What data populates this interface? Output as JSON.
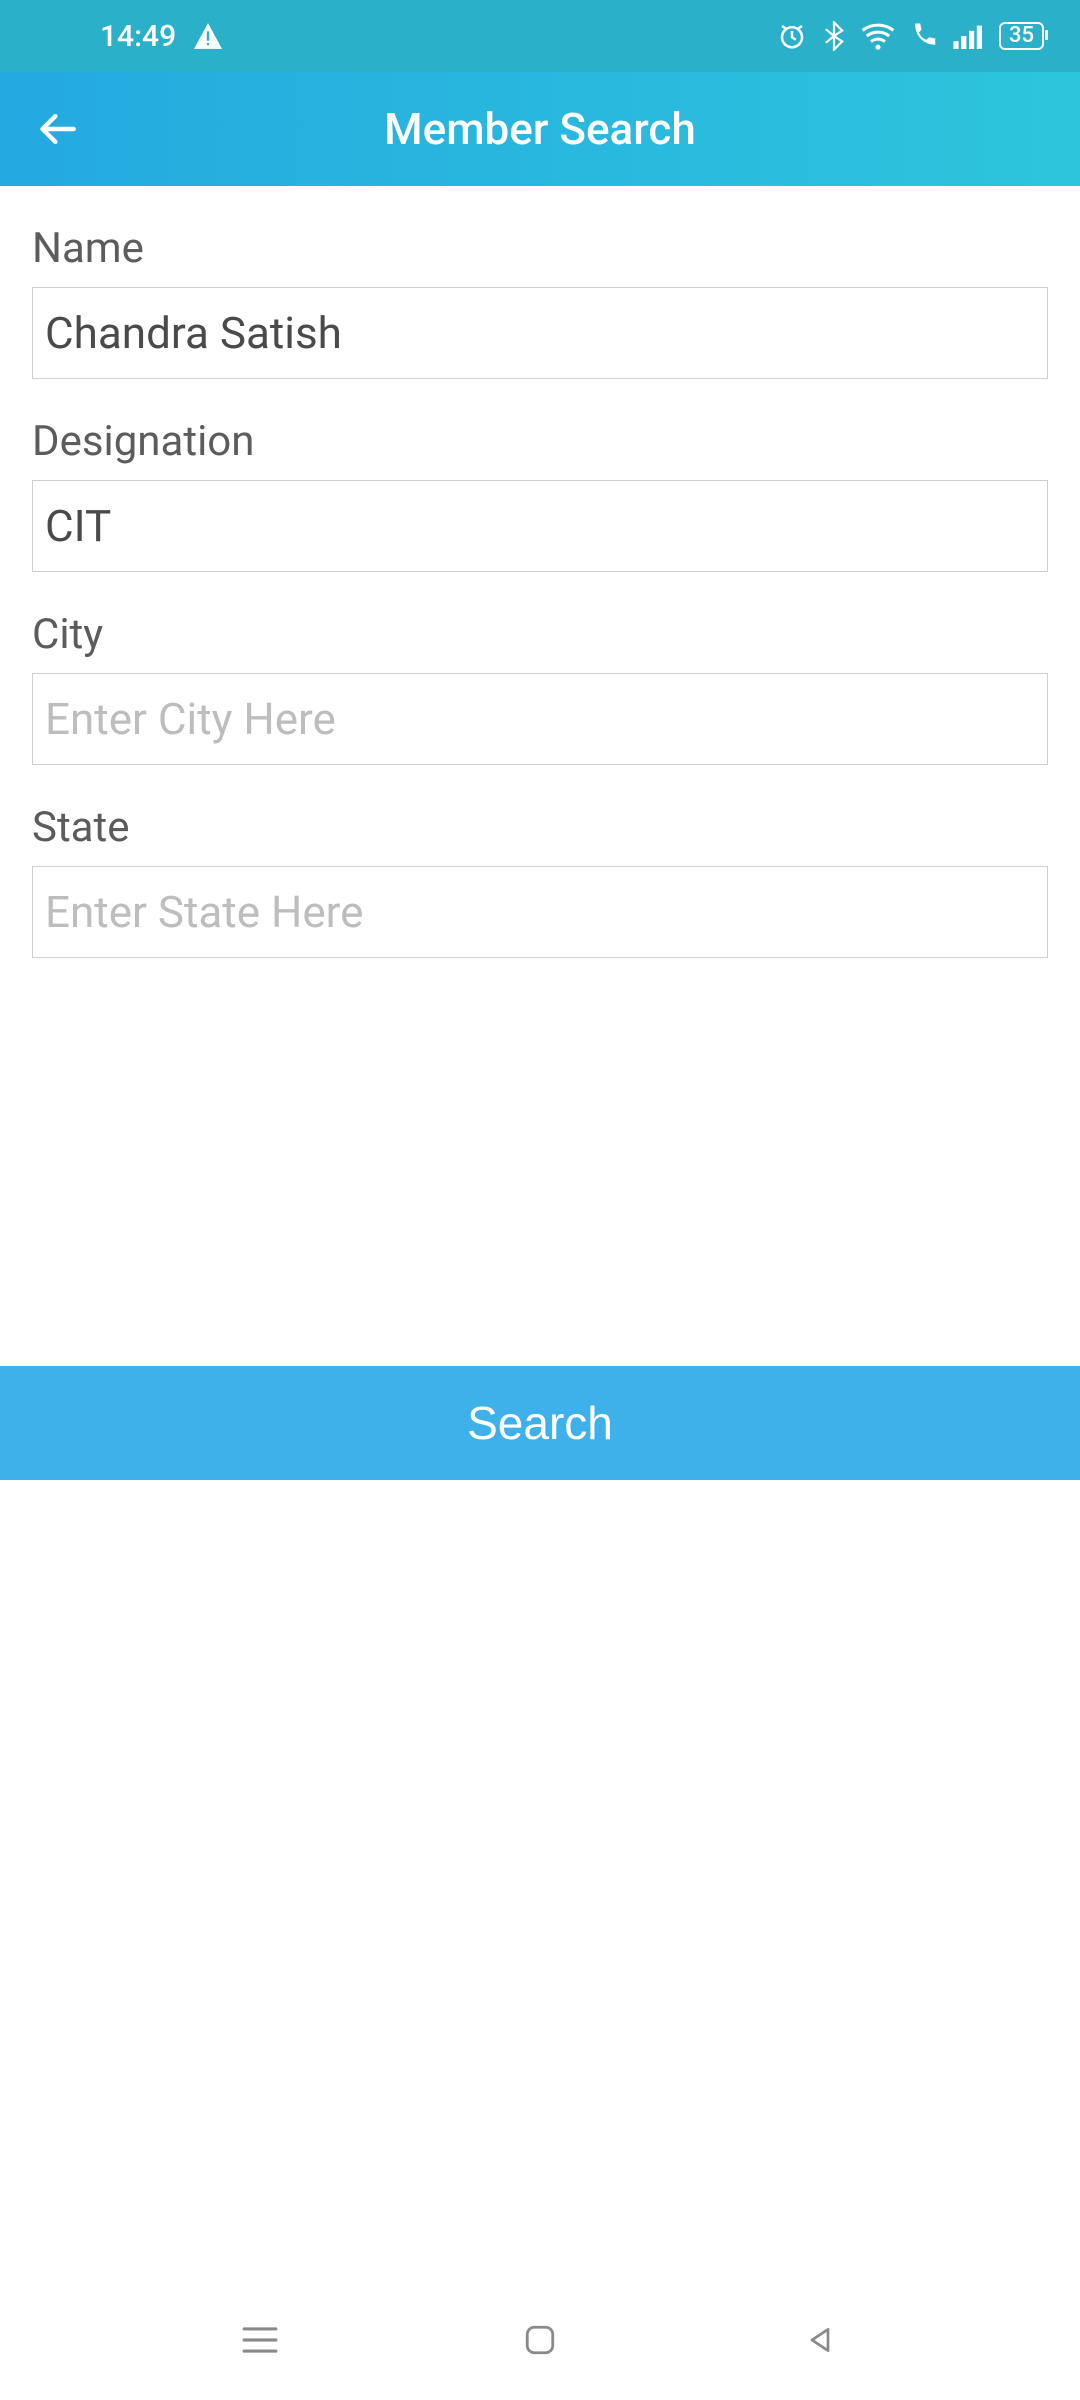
{
  "status": {
    "time": "14:49",
    "battery": "35"
  },
  "header": {
    "title": "Member Search"
  },
  "form": {
    "name": {
      "label": "Name",
      "value": "Chandra Satish",
      "placeholder": ""
    },
    "designation": {
      "label": "Designation",
      "value": "CIT",
      "placeholder": ""
    },
    "city": {
      "label": "City",
      "value": "",
      "placeholder": "Enter City Here"
    },
    "state": {
      "label": "State",
      "value": "",
      "placeholder": "Enter State Here"
    }
  },
  "actions": {
    "search": "Search"
  }
}
